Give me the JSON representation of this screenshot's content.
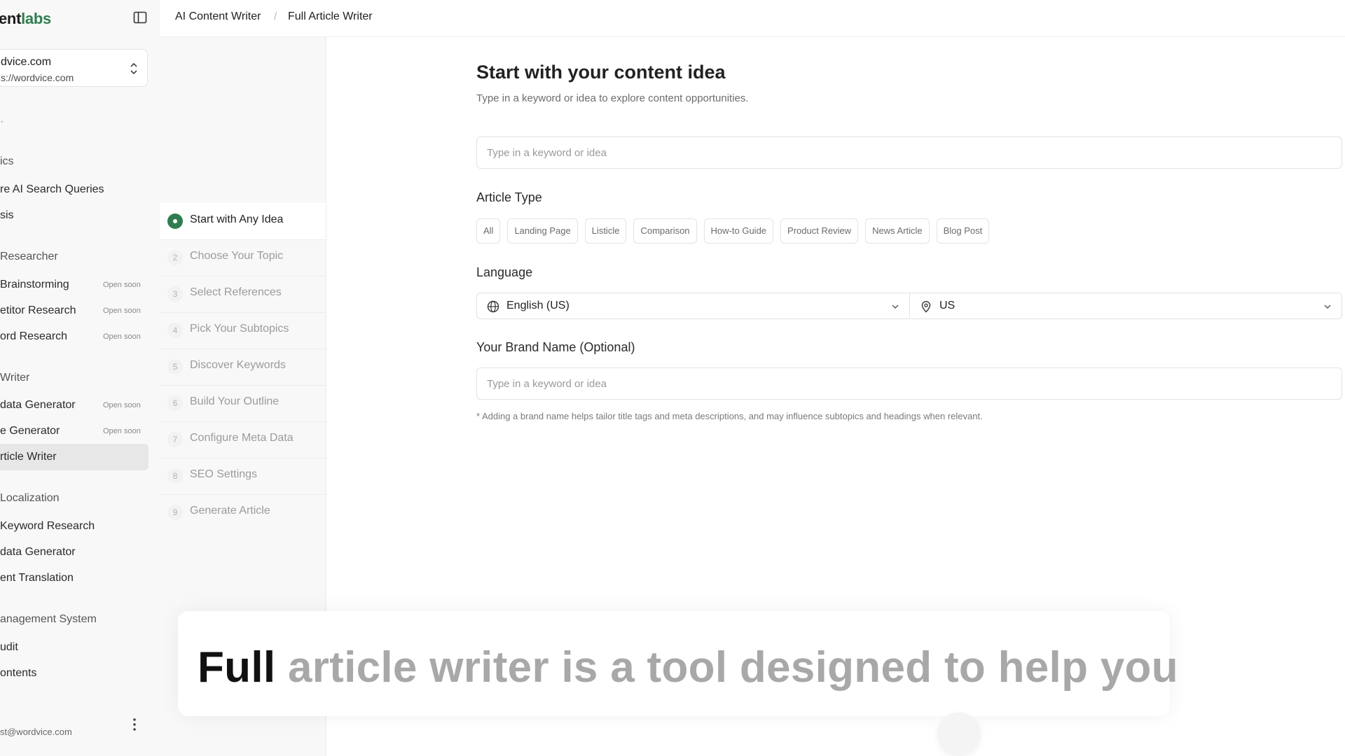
{
  "sidebar": {
    "brand_prefix": "ent",
    "brand_suffix": "labs",
    "site": {
      "name": "dvice.com",
      "url": "s://wordvice.com"
    },
    "items": [
      {
        "label": "ics",
        "kind": "section"
      },
      {
        "label": "re AI Search Queries",
        "kind": "item"
      },
      {
        "label": "sis",
        "kind": "item"
      },
      {
        "label": "Researcher",
        "kind": "section"
      },
      {
        "label": "Brainstorming",
        "kind": "item",
        "badge": "Open soon"
      },
      {
        "label": "etitor Research",
        "kind": "item",
        "badge": "Open soon"
      },
      {
        "label": "ord Research",
        "kind": "item",
        "badge": "Open soon"
      },
      {
        "label": "Writer",
        "kind": "section"
      },
      {
        "label": "data Generator",
        "kind": "item",
        "badge": "Open soon"
      },
      {
        "label": "e Generator",
        "kind": "item",
        "badge": "Open soon"
      },
      {
        "label": "rticle Writer",
        "kind": "item",
        "active": true
      },
      {
        "label": "Localization",
        "kind": "section"
      },
      {
        "label": "Keyword Research",
        "kind": "item"
      },
      {
        "label": "data Generator",
        "kind": "item"
      },
      {
        "label": "ent Translation",
        "kind": "item"
      },
      {
        "label": "anagement System",
        "kind": "section"
      },
      {
        "label": "udit",
        "kind": "item"
      },
      {
        "label": "ontents",
        "kind": "item"
      }
    ],
    "user_email": "st@wordvice.com"
  },
  "breadcrumb": {
    "parent": "AI Content Writer",
    "separator": "/",
    "current": "Full Article Writer"
  },
  "steps": [
    {
      "num": "",
      "label": "Start with Any Idea",
      "active": true
    },
    {
      "num": "2",
      "label": "Choose Your Topic"
    },
    {
      "num": "3",
      "label": "Select References"
    },
    {
      "num": "4",
      "label": "Pick Your Subtopics"
    },
    {
      "num": "5",
      "label": "Discover Keywords"
    },
    {
      "num": "6",
      "label": "Build Your Outline"
    },
    {
      "num": "7",
      "label": "Configure Meta Data"
    },
    {
      "num": "8",
      "label": "SEO Settings"
    },
    {
      "num": "9",
      "label": "Generate Article"
    }
  ],
  "main": {
    "title": "Start with your content idea",
    "subtitle": "Type in a keyword or idea to explore content opportunities.",
    "idea_placeholder": "Type in a keyword or idea",
    "article_type_heading": "Article Type",
    "article_types": [
      "All",
      "Landing Page",
      "Listicle",
      "Comparison",
      "How-to Guide",
      "Product Review",
      "News Article",
      "Blog Post"
    ],
    "language_heading": "Language",
    "language_value": "English (US)",
    "region_value": "US",
    "brand_heading": "Your Brand Name (Optional)",
    "brand_placeholder": "Type in a keyword or idea",
    "brand_note": "* Adding a brand name helps tailor title tags and meta descriptions, and may influence subtopics and headings when relevant."
  },
  "caption": {
    "strong": "Full",
    "faded": "article writer is a tool designed to help you"
  },
  "colors": {
    "accent": "#2f7d4f",
    "sidebar_bg": "#f7f8f7",
    "active_item_bg": "#e6e7e6"
  }
}
